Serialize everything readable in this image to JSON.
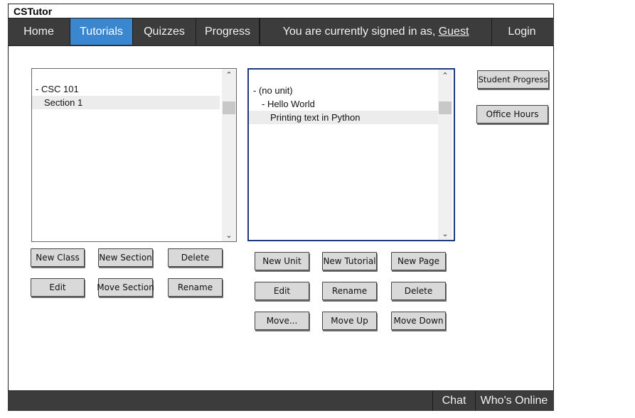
{
  "app": {
    "title": "CSTutor"
  },
  "nav": {
    "items": [
      {
        "label": "Home",
        "active": false
      },
      {
        "label": "Tutorials",
        "active": true
      },
      {
        "label": "Quizzes",
        "active": false
      },
      {
        "label": "Progress",
        "active": false
      }
    ],
    "signin_prefix": "You are currently signed in as, ",
    "signin_user": "Guest",
    "login": "Login"
  },
  "left_tree": {
    "rows": [
      {
        "label": "- CSC 101",
        "selected": false
      },
      {
        "label": "Section 1",
        "selected": true
      }
    ],
    "scroll_up_icon": "chevron-up-icon",
    "scroll_down_icon": "chevron-down-icon"
  },
  "right_tree": {
    "rows": [
      {
        "label": "- (no unit)",
        "selected": false
      },
      {
        "label": "- Hello World",
        "selected": false
      },
      {
        "label": "Printing text in Python",
        "selected": true
      }
    ],
    "focus_color": "#1f3a7a"
  },
  "left_buttons": {
    "new_class": "New Class",
    "new_section": "New Section",
    "delete": "Delete",
    "edit": "Edit",
    "move_section": "Move Section",
    "rename": "Rename"
  },
  "right_buttons": {
    "new_unit": "New Unit",
    "new_tutorial": "New Tutorial",
    "new_page": "New Page",
    "edit": "Edit",
    "rename": "Rename",
    "delete": "Delete",
    "move": "Move...",
    "move_up": "Move Up",
    "move_down": "Move Down"
  },
  "side_buttons": {
    "student_progress": "Student Progress",
    "office_hours": "Office Hours"
  },
  "footer": {
    "chat": "Chat",
    "whos_online": "Who's Online"
  },
  "colors": {
    "navbar": "#3c3c3c",
    "active_tab": "#3a86cf",
    "button": "#d9d9d9"
  }
}
